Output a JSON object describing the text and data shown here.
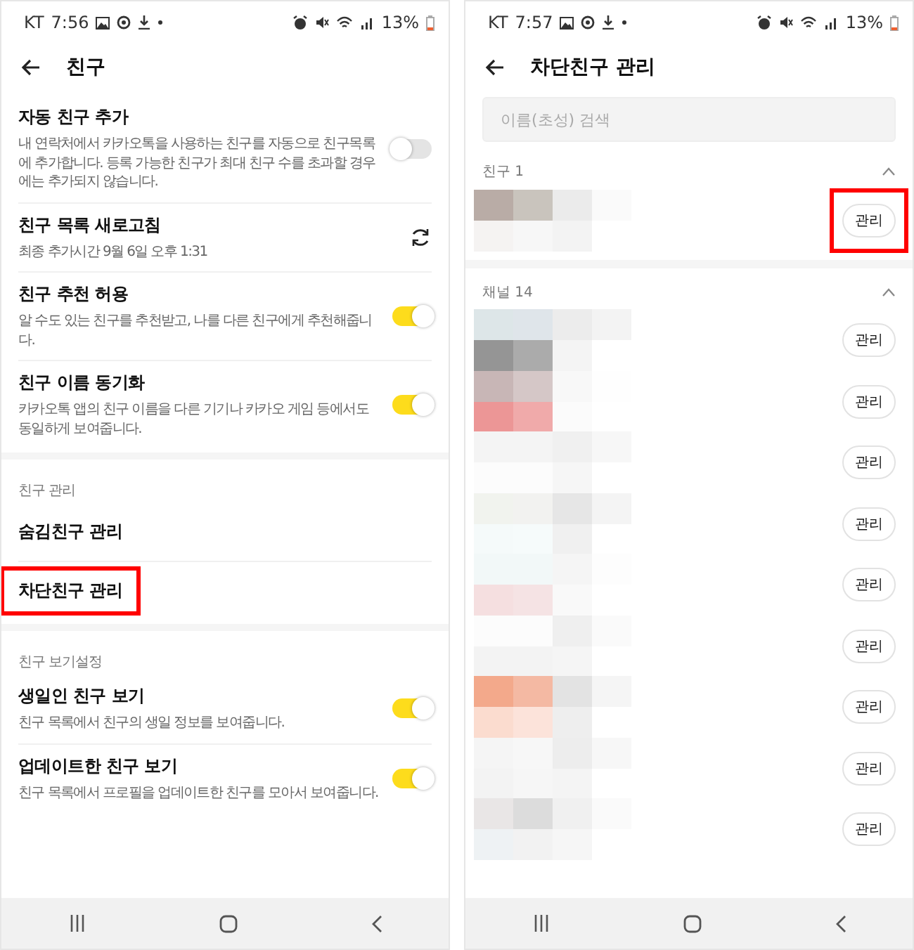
{
  "friend_settings": {
    "status_bar": {
      "carrier": "KT",
      "time": "7:56",
      "battery": "13%"
    },
    "title": "친구",
    "sections": [
      {
        "items": [
          {
            "kind": "toggle",
            "title": "자동 친구 추가",
            "description": "내 연락처에서 카카오톡을 사용하는 친구를 자동으로 친구목록에 추가합니다. 등록 가능한 친구가 최대 친구 수를 초과할 경우에는 추가되지 않습니다.",
            "on": false
          },
          {
            "kind": "refresh",
            "title": "친구 목록 새로고침",
            "description": "최종 추가시간 9월 6일 오후 1:31"
          },
          {
            "kind": "toggle",
            "title": "친구 추천 허용",
            "description": "알 수도 있는 친구를 추천받고, 나를 다른 친구에게 추천해줍니다.",
            "on": true
          },
          {
            "kind": "toggle",
            "title": "친구 이름 동기화",
            "description": "카카오톡 앱의 친구 이름을 다른 기기나 카카오 게임 등에서도 동일하게 보여줍니다.",
            "on": true
          }
        ]
      },
      {
        "label": "친구 관리",
        "items": [
          {
            "kind": "link",
            "title": "숨김친구 관리",
            "highlighted": false
          },
          {
            "kind": "link",
            "title": "차단친구 관리",
            "highlighted": true
          }
        ]
      },
      {
        "label": "친구 보기설정",
        "items": [
          {
            "kind": "toggle",
            "title": "생일인 친구 보기",
            "description": "친구 목록에서 친구의 생일 정보를 보여줍니다.",
            "on": true
          },
          {
            "kind": "toggle",
            "title": "업데이트한 친구 보기",
            "description": "친구 목록에서 프로필을 업데이트한 친구를 모아서 보여줍니다.",
            "on": true
          }
        ]
      }
    ]
  },
  "blocked_friends": {
    "status_bar": {
      "carrier": "KT",
      "time": "7:57",
      "battery": "13%"
    },
    "title": "차단친구 관리",
    "search": {
      "placeholder": "이름(초성) 검색"
    },
    "groups": [
      {
        "label": "친구 1",
        "expanded": true,
        "rows": [
          {
            "button": "관리",
            "highlighted": true
          }
        ]
      },
      {
        "label": "채널 14",
        "expanded": true,
        "rows": [
          {
            "button": "관리",
            "highlighted": false
          },
          {
            "button": "관리",
            "highlighted": false
          },
          {
            "button": "관리",
            "highlighted": false
          },
          {
            "button": "관리",
            "highlighted": false
          },
          {
            "button": "관리",
            "highlighted": false
          },
          {
            "button": "관리",
            "highlighted": false
          },
          {
            "button": "관리",
            "highlighted": false
          },
          {
            "button": "관리",
            "highlighted": false
          },
          {
            "button": "관리",
            "highlighted": false
          }
        ]
      }
    ]
  }
}
